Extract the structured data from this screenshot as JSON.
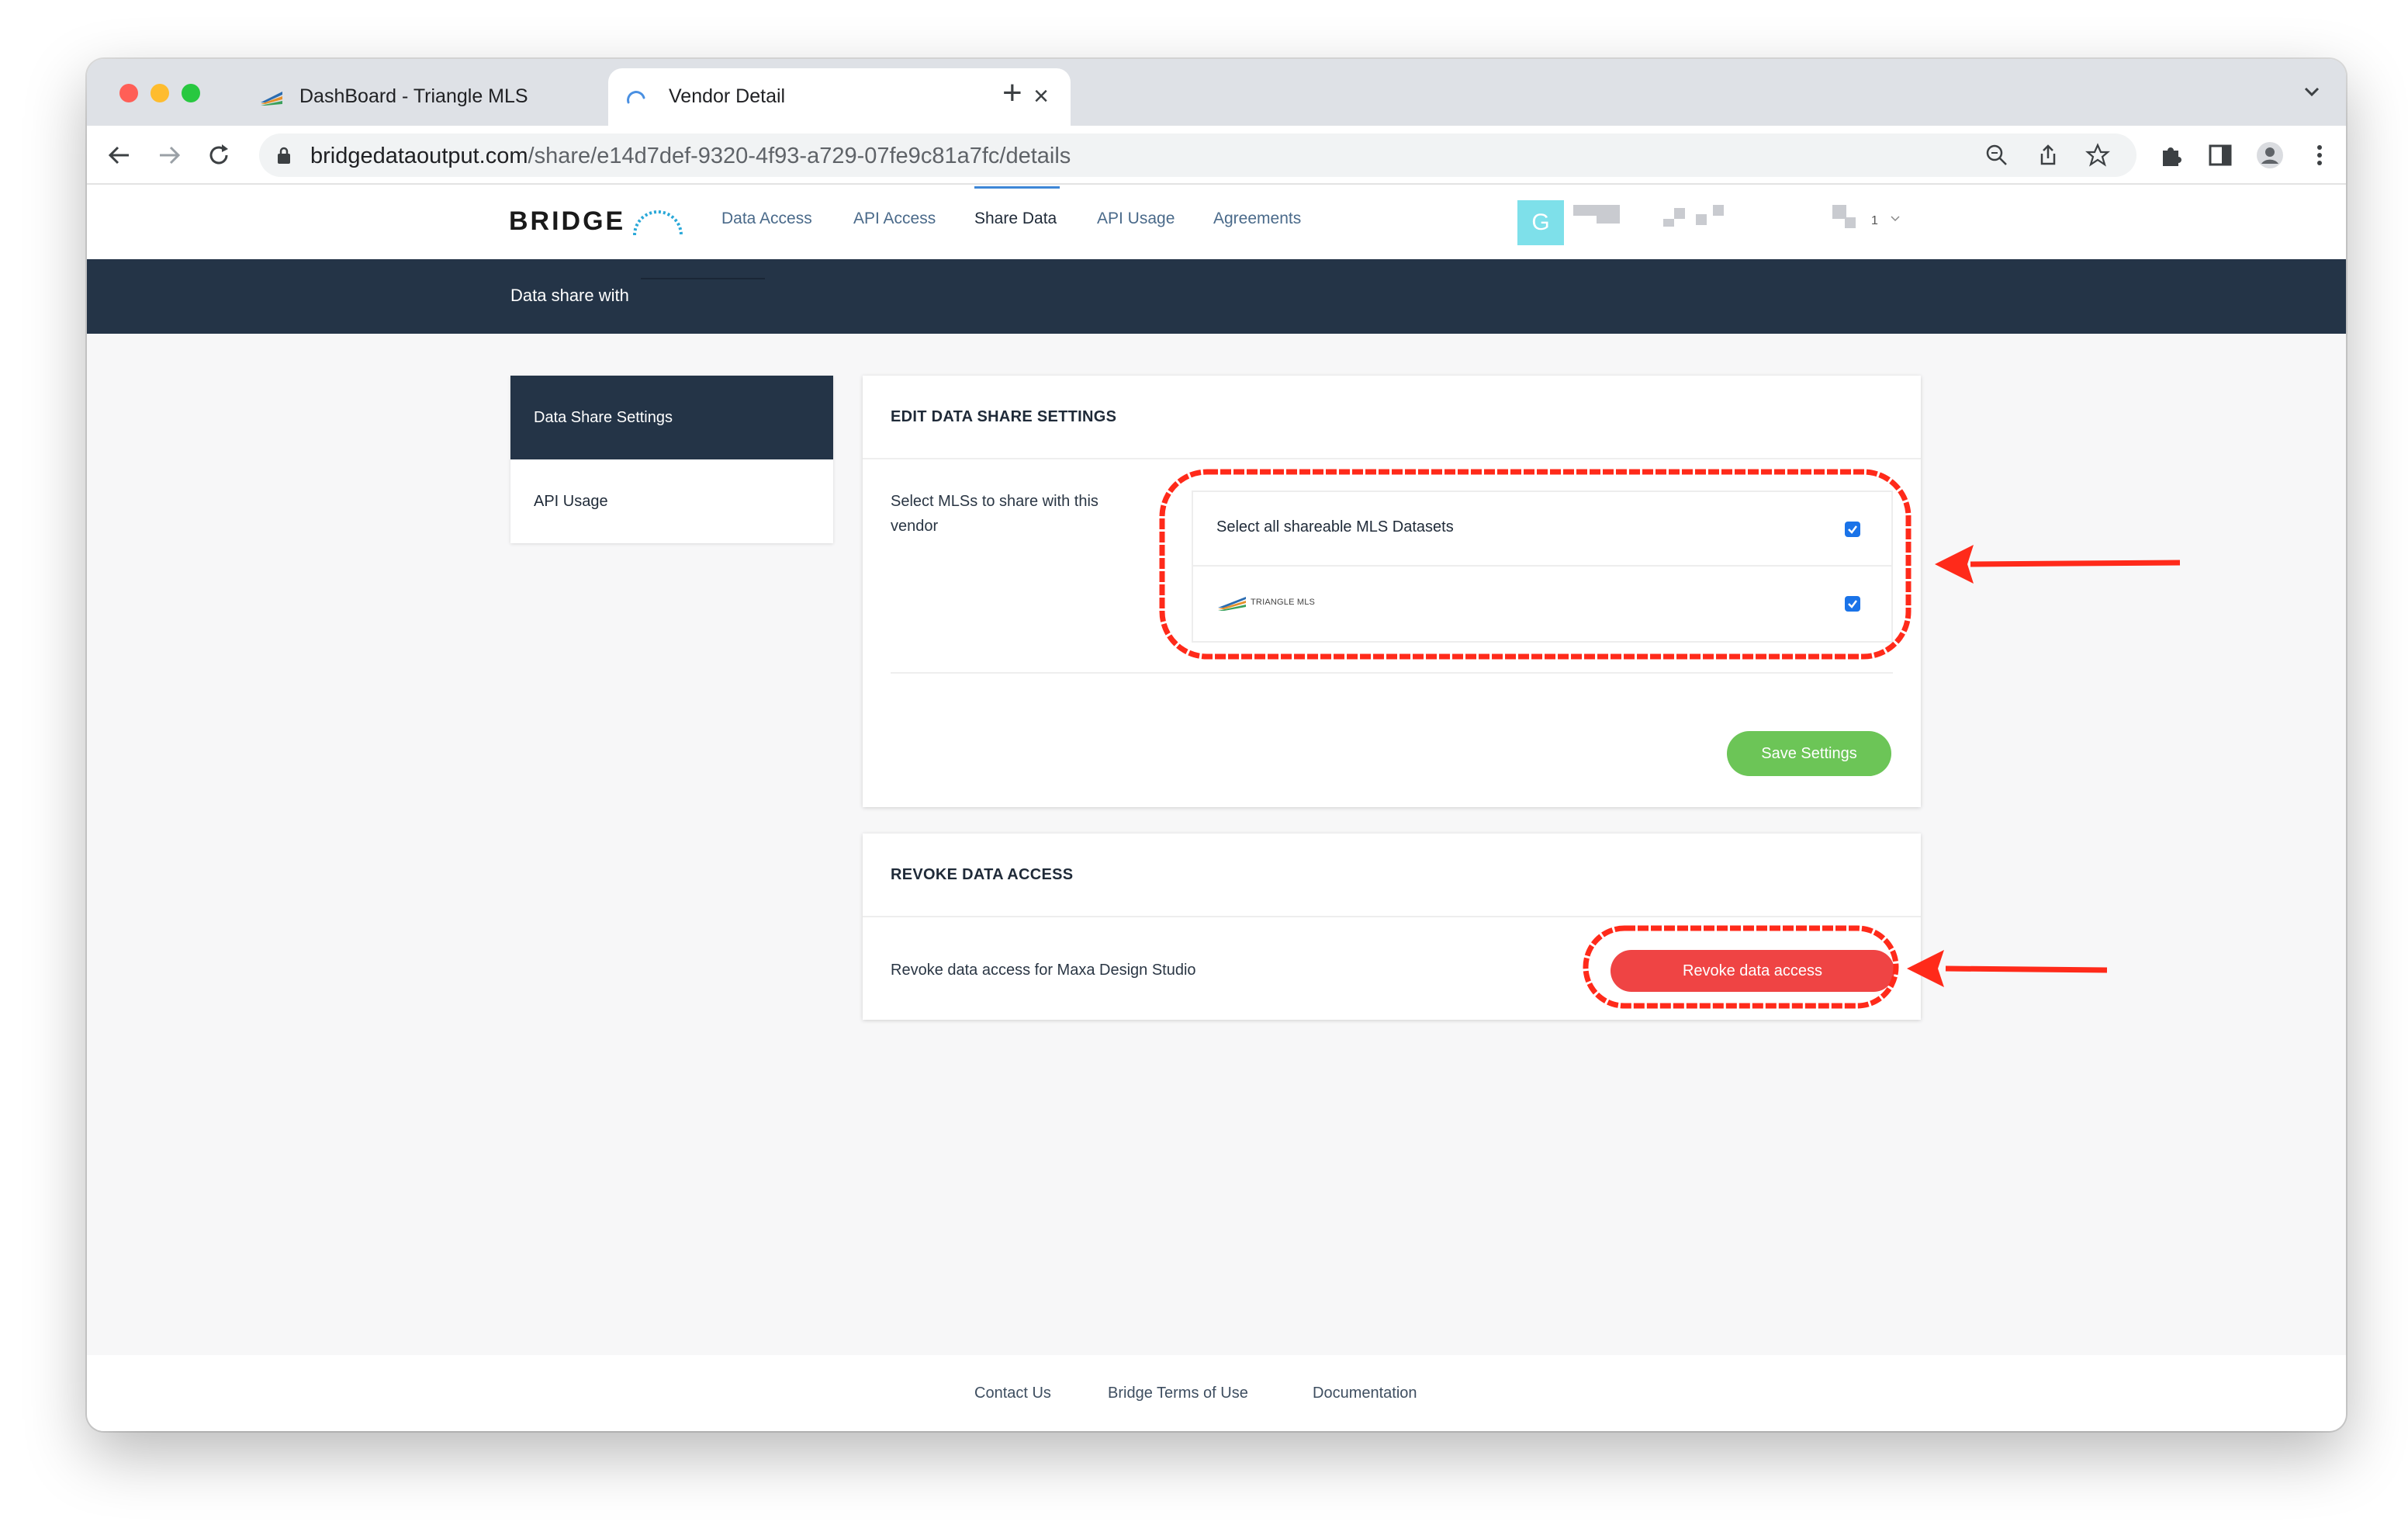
{
  "browser": {
    "tabs": [
      {
        "title": "DashBoard - Triangle MLS",
        "active": false
      },
      {
        "title": "Vendor Detail",
        "active": true
      }
    ],
    "url_host": "bridgedataoutput.com",
    "url_path": "/share/e14d7def-9320-4f93-a729-07fe9c81a7fc/details"
  },
  "header": {
    "logo": "BRIDGE",
    "nav": [
      "Data Access",
      "API Access",
      "Share Data",
      "API Usage",
      "Agreements"
    ],
    "active_nav": "Share Data",
    "avatar_letter": "G",
    "user_count": "1"
  },
  "banner": {
    "title": "Data share with"
  },
  "sidebar": {
    "items": [
      {
        "label": "Data Share Settings",
        "active": true
      },
      {
        "label": "API Usage",
        "active": false
      }
    ]
  },
  "settings_card": {
    "header": "EDIT DATA SHARE SETTINGS",
    "prompt": "Select MLSs to share with this vendor",
    "select_all_label": "Select all shareable MLS Datasets",
    "select_all_checked": true,
    "mls_name": "TRIANGLE MLS",
    "mls_checked": true,
    "save_button": "Save Settings"
  },
  "revoke_card": {
    "header": "REVOKE DATA ACCESS",
    "text": "Revoke data access for Maxa Design Studio",
    "button": "Revoke data access"
  },
  "footer": {
    "links": [
      "Contact Us",
      "Bridge Terms of Use",
      "Documentation"
    ]
  },
  "colors": {
    "banner": "#243447",
    "save_green": "#6cc557",
    "revoke_red": "#ef4444",
    "annotation_red": "#ff2a1a",
    "checkbox_blue": "#1a73e8"
  }
}
